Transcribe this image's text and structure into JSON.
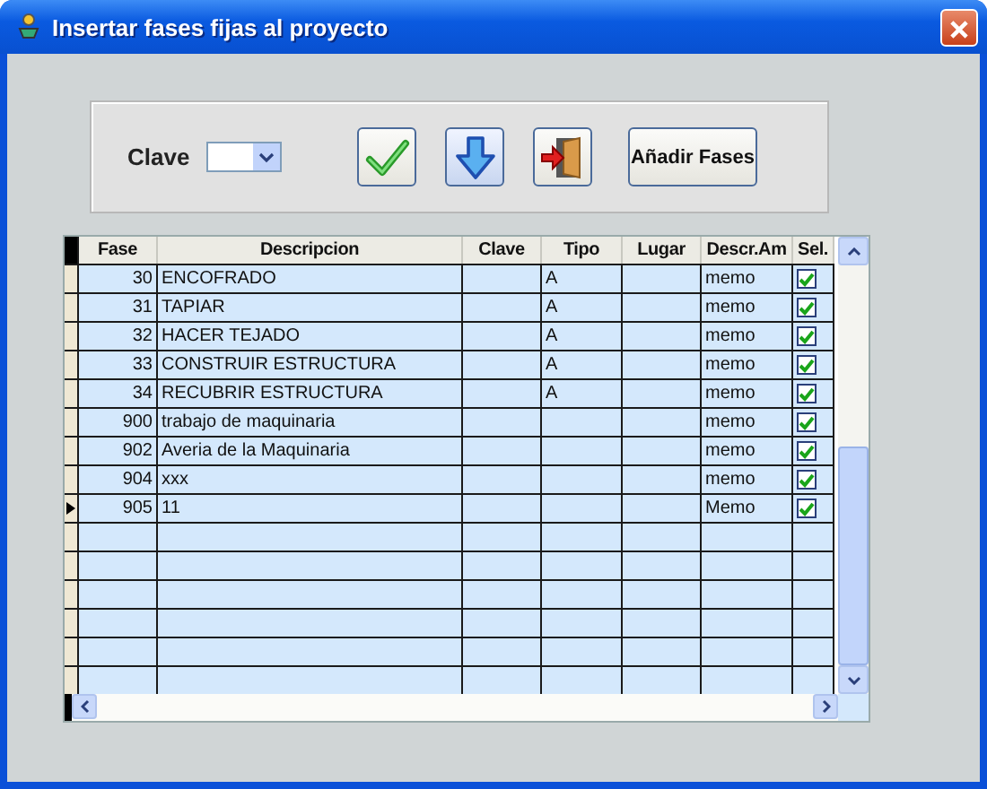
{
  "window": {
    "title": "Insertar fases fijas al proyecto"
  },
  "filter": {
    "label": "Clave"
  },
  "toolbar": [
    {
      "kind": "check"
    },
    {
      "kind": "down"
    },
    {
      "kind": "exit"
    },
    {
      "kind": "text",
      "label": "Añadir Fases"
    }
  ],
  "table": {
    "columns": [
      "Fase",
      "Descripcion",
      "Clave",
      "Tipo",
      "Lugar",
      "Descr.Am",
      "Sel."
    ],
    "rows": [
      {
        "fase": "30",
        "descripcion": "ENCOFRADO",
        "tipo": "A",
        "descr": "memo",
        "sel": true,
        "current": false
      },
      {
        "fase": "31",
        "descripcion": "TAPIAR",
        "tipo": "A",
        "descr": "memo",
        "sel": true,
        "current": false
      },
      {
        "fase": "32",
        "descripcion": "HACER TEJADO",
        "tipo": "A",
        "descr": "memo",
        "sel": true,
        "current": false
      },
      {
        "fase": "33",
        "descripcion": "CONSTRUIR ESTRUCTURA",
        "tipo": "A",
        "descr": "memo",
        "sel": true,
        "current": false
      },
      {
        "fase": "34",
        "descripcion": "RECUBRIR ESTRUCTURA",
        "tipo": "A",
        "descr": "memo",
        "sel": true,
        "current": false
      },
      {
        "fase": "900",
        "descripcion": "trabajo de maquinaria",
        "descr": "memo",
        "sel": true,
        "current": false
      },
      {
        "fase": "902",
        "descripcion": "Averia de la Maquinaria",
        "descr": "memo",
        "sel": true,
        "current": false
      },
      {
        "fase": "904",
        "descripcion": "xxx",
        "descr": "memo",
        "sel": true,
        "current": false
      },
      {
        "fase": "905",
        "descripcion": "11",
        "descr": "Memo",
        "sel": true,
        "current": true
      }
    ]
  }
}
